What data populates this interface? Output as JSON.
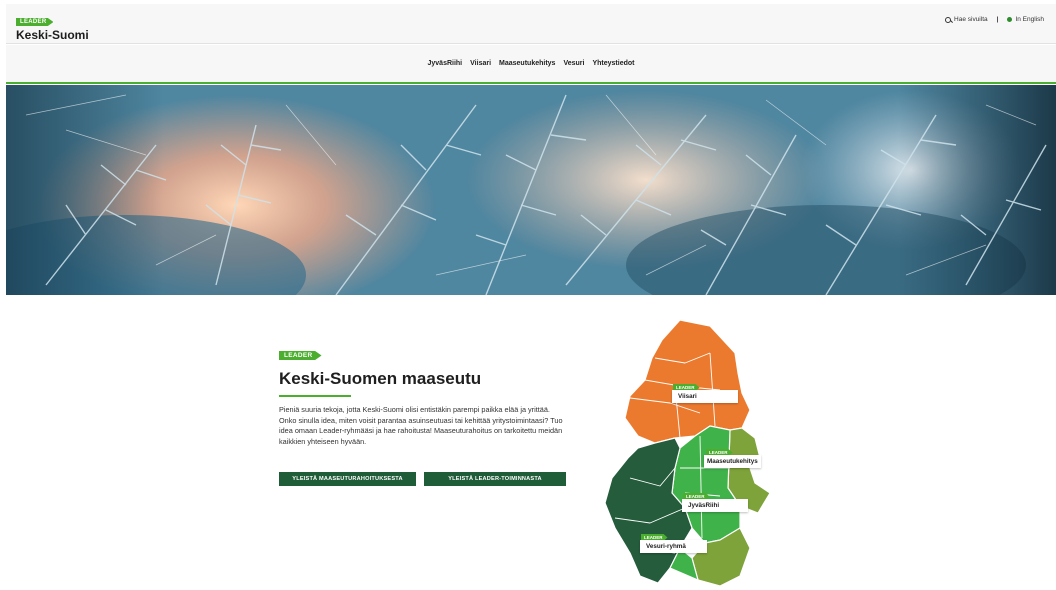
{
  "header": {
    "leader_tag": "LEADER",
    "site_title": "Keski-Suomi",
    "search_label": "Hae sivuilta",
    "separator": "|",
    "language_label": "In English"
  },
  "nav": {
    "items": [
      {
        "label": "JyväsRiihi"
      },
      {
        "label": "Viisari"
      },
      {
        "label": "Maaseutukehitys"
      },
      {
        "label": "Vesuri"
      },
      {
        "label": "Yhteystiedot"
      }
    ]
  },
  "content": {
    "leader_tag": "LEADER",
    "heading": "Keski-Suomen maaseutu",
    "description": "Pieniä suuria tekoja, jotta Keski-Suomi olisi entistäkin parempi paikka elää ja yrittää.\nOnko sinulla idea, miten voisit parantaa asuinseutuasi tai kehittää yritystoimintaasi? Tuo idea omaan Leader-ryhmääsi ja hae rahoitusta! Maaseuturahoitus on tarkoitettu meidän kaikkien yhteiseen hyvään.",
    "button_rural_funding": "YLEISTÄ MAASEUTURAHOITUKSESTA",
    "button_leader_activity": "YLEISTÄ LEADER-TOIMINNASTA"
  },
  "map": {
    "tag": "LEADER",
    "regions": [
      {
        "label": "Viisari",
        "color": "#ec7a2e"
      },
      {
        "label": "Maaseutukehitys",
        "color": "#7ea33a"
      },
      {
        "label": "JyväsRiihi",
        "color": "#3fb24a"
      },
      {
        "label": "Vesuri-ryhmä",
        "color": "#245c3c"
      }
    ]
  },
  "colors": {
    "accent": "#4cae2f",
    "button": "#1f5c38"
  }
}
